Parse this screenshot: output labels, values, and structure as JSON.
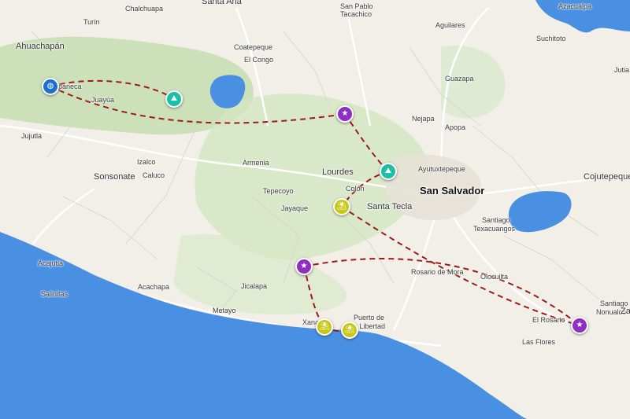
{
  "map": {
    "colors": {
      "land": "#f2efe9",
      "water": "#4a90e2",
      "forest": "#c5deb0",
      "route": "#9b1b1b",
      "marker_purple": "#8e2fbf",
      "marker_teal": "#1bbfa4",
      "marker_yellow": "#c8c814",
      "marker_blue": "#1a6fd1"
    },
    "labels": {
      "chalchuapa": "Chalchuapa",
      "santa_ana": "Santa Ana",
      "turin": "Turín",
      "ahuachapan": "Ahuachapán",
      "apaneca": "paneca",
      "juayua": "Juayúa",
      "juquila": "Jujutla",
      "coatepeque": "Coatepeque",
      "el_congo": "El Congo",
      "san_pablo": "San Pablo",
      "tacachico": "Tacachico",
      "aguilares": "Aguilares",
      "suchitoto": "Suchitoto",
      "azacualpa": "Azacualpa",
      "jutiapa": "Jutia",
      "guazapa": "Guazapa",
      "nejapa": "Nejapa",
      "apopa": "Apopa",
      "izalco": "Izalco",
      "caluco": "Caluco",
      "sonsonate": "Sonsonate",
      "armenia": "Armenia",
      "lourdes": "Lourdes",
      "colon": "Colón",
      "tepecoyo": "Tepecoyo",
      "jayaque": "Jayaque",
      "santa_tecla": "Santa Tecla",
      "ayutuxtepeque": "Ayutuxtepeque",
      "san_salvador": "San Salvador",
      "cojutepeque": "Cojutepeque",
      "santiago_texacuangos_1": "Santiago",
      "santiago_texacuangos_2": "Texacuangos",
      "acajutla": "Acajutla",
      "salinitas": "Salinitas",
      "acachapa": "Acachapa",
      "jicalapa": "Jicalapa",
      "metayo": "Metayo",
      "xanadu": "Xana",
      "puerto_1": "Puerto de",
      "puerto_2": "a Libertad",
      "rosario_de_mora": "Rosario de Mora",
      "olocuilta": "Olocuilta",
      "el_rosario": "El Rosario",
      "las_flores": "Las Flores",
      "santiago_nonualco_1": "Santiago",
      "santiago_nonualco_2": "Nonualco",
      "za": "Za"
    },
    "markers": [
      {
        "id": "apaneca",
        "type": "globe",
        "icon": "globe-icon",
        "glyph": "◍",
        "color": "marker_blue"
      },
      {
        "id": "hike-juayua",
        "type": "hiking",
        "icon": "hiking-icon",
        "glyph": "⛰",
        "color": "marker_teal"
      },
      {
        "id": "star-north",
        "type": "star",
        "icon": "star-icon",
        "glyph": "★",
        "color": "marker_purple"
      },
      {
        "id": "hike-tecla",
        "type": "hiking",
        "icon": "hiking-icon",
        "glyph": "⛰",
        "color": "marker_teal"
      },
      {
        "id": "beach-jayaque",
        "type": "beach",
        "icon": "beach-umbrella-icon",
        "glyph": "⛱",
        "color": "marker_yellow"
      },
      {
        "id": "star-west",
        "type": "star",
        "icon": "star-icon",
        "glyph": "★",
        "color": "marker_purple"
      },
      {
        "id": "beach-xanadu",
        "type": "beach",
        "icon": "beach-umbrella-icon",
        "glyph": "⛱",
        "color": "marker_yellow"
      },
      {
        "id": "beach-libertad",
        "type": "beach",
        "icon": "beach-umbrella-icon",
        "glyph": "⛱",
        "color": "marker_yellow"
      },
      {
        "id": "star-east",
        "type": "star",
        "icon": "star-icon",
        "glyph": "★",
        "color": "marker_purple"
      }
    ]
  }
}
